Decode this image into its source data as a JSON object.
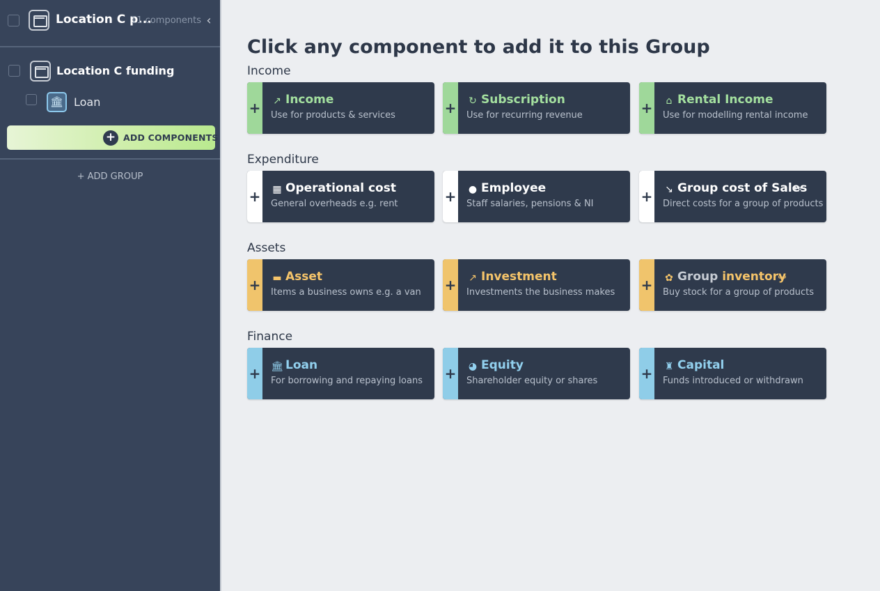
{
  "colors": {
    "income_accent": "#9fd89a",
    "expenditure_accent": "#ffffff",
    "assets_accent": "#f0c46c",
    "finance_accent": "#8fcde8",
    "card_bg": "#2f3a4c",
    "sidebar_bg": "#37445a",
    "add_button_gradient": "#cdeea8"
  },
  "sidebar": {
    "header": {
      "title": "Location C p...",
      "count": "11 components",
      "icon": "folder-icon",
      "collapse_icon": "chevron-left-icon"
    },
    "group": {
      "title": "Location C funding",
      "icon": "folder-icon"
    },
    "item": {
      "label": "Loan",
      "icon": "bank-icon"
    },
    "add_components_label": "ADD COMPONENTS",
    "add_group_label": "+ ADD GROUP"
  },
  "main": {
    "title": "Click any component to add it to this Group",
    "sections": [
      {
        "label": "Income",
        "cards": [
          {
            "title": "Income",
            "desc": "Use for products & services",
            "icon": "trend-up-icon"
          },
          {
            "title": "Subscription",
            "desc": "Use for recurring revenue",
            "icon": "recurring-icon"
          },
          {
            "title": "Rental Income",
            "desc": "Use for modelling rental income",
            "icon": "home-icon"
          }
        ]
      },
      {
        "label": "Expenditure",
        "cards": [
          {
            "title": "Operational cost",
            "desc": "General overheads e.g. rent",
            "icon": "building-icon"
          },
          {
            "title": "Employee",
            "desc": "Staff salaries, pensions & NI",
            "icon": "person-icon"
          },
          {
            "title": "Group cost of Sales",
            "desc": "Direct costs for a group of products",
            "icon": "trend-down-icon"
          }
        ]
      },
      {
        "label": "Assets",
        "cards": [
          {
            "title": "Asset",
            "desc": "Items a business owns e.g. a van",
            "icon": "truck-icon"
          },
          {
            "title": "Investment",
            "desc": "Investments the business makes",
            "icon": "chart-line-icon"
          },
          {
            "title_prefix": "Group",
            "title": "inventory",
            "desc": "Buy stock for a group of products",
            "icon": "boxes-icon"
          }
        ]
      },
      {
        "label": "Finance",
        "cards": [
          {
            "title": "Loan",
            "desc": "For borrowing and repaying loans",
            "icon": "bank-icon"
          },
          {
            "title": "Equity",
            "desc": "Shareholder equity or shares",
            "icon": "pie-chart-icon"
          },
          {
            "title": "Capital",
            "desc": "Funds introduced or withdrawn",
            "icon": "money-bag-icon"
          }
        ]
      }
    ]
  }
}
